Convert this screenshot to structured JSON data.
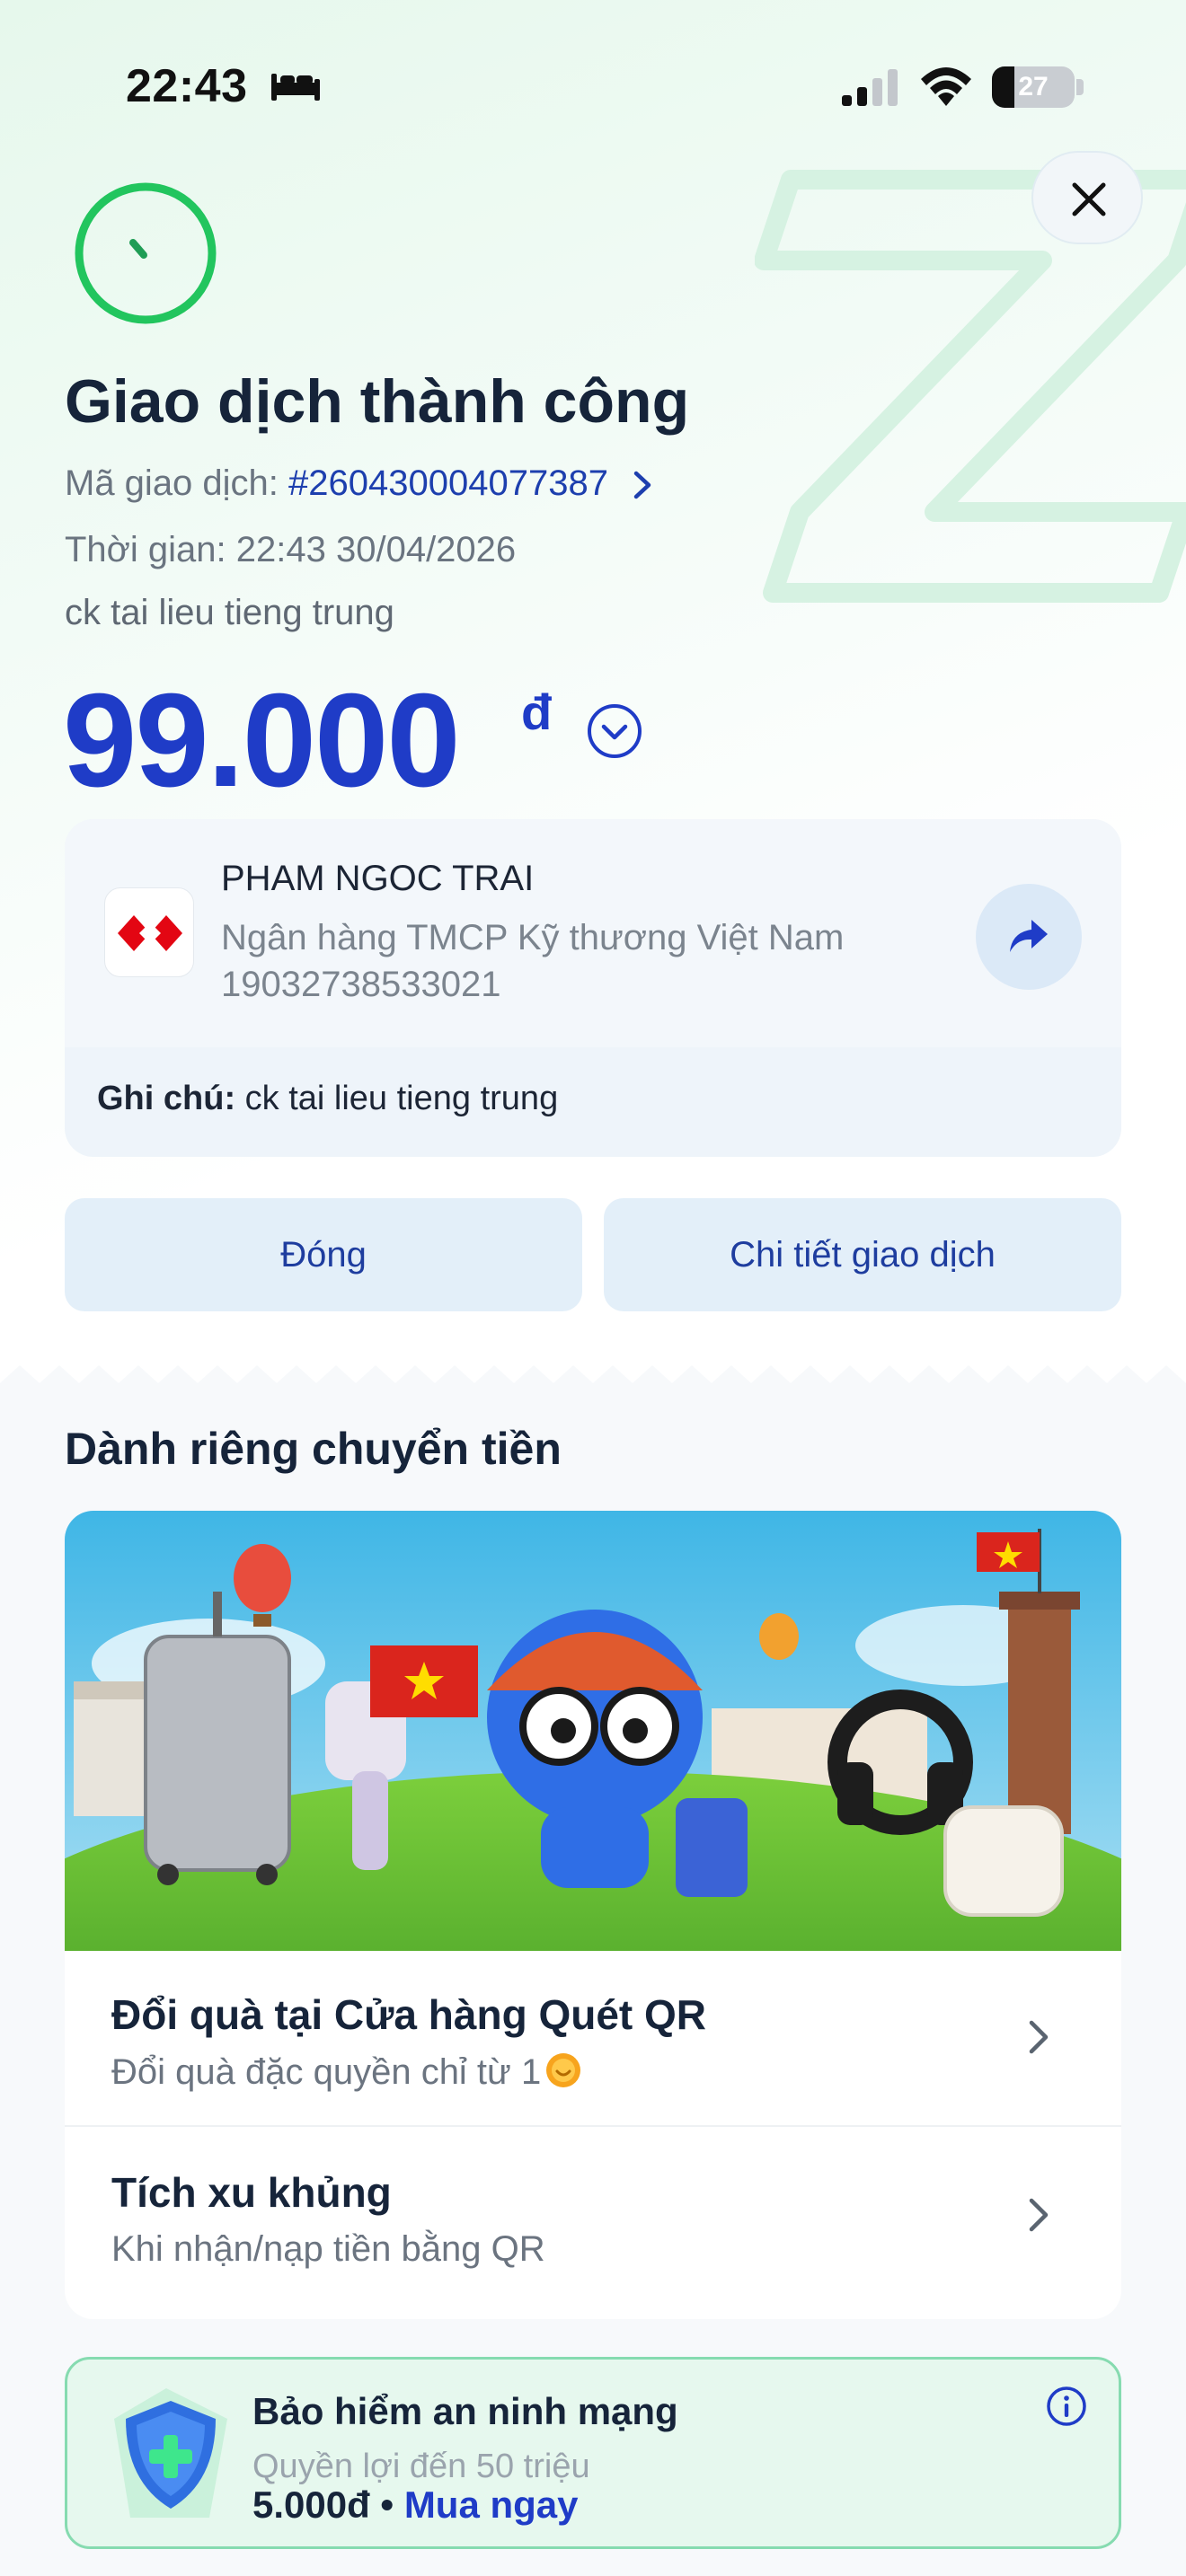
{
  "status_bar": {
    "time": "22:43",
    "battery_level": "27",
    "battery_fraction": 0.27
  },
  "header": {
    "title": "Giao dịch thành công",
    "txn_label": "Mã giao dịch: ",
    "txn_code": "#260430004077387",
    "time_text": "Thời gian: 22:43 30/04/2026",
    "note": "ck tai lieu tieng trung",
    "amount": "99.000",
    "currency": "đ"
  },
  "recipient": {
    "name": "PHAM NGOC TRAI",
    "bank": "Ngân hàng TMCP Kỹ thương Việt Nam",
    "account": "19032738533021",
    "memo_label": "Ghi chú:",
    "memo_value": " ck tai lieu tieng trung"
  },
  "actions": {
    "close_label": "Đóng",
    "detail_label": "Chi tiết giao dịch"
  },
  "section": {
    "title": "Dành riêng chuyển tiền"
  },
  "promos": [
    {
      "title": "Đổi quà tại Cửa hàng Quét QR",
      "subtitle": "Đổi quà đặc quyền chỉ từ 1"
    },
    {
      "title": "Tích xu khủng",
      "subtitle": "Khi nhận/nạp tiền bằng QR"
    }
  ],
  "insurance": {
    "title": "Bảo hiểm an ninh mạng",
    "benefit": "Quyền lợi đến 50 triệu",
    "price": "5.000đ",
    "separator": " • ",
    "buy_label": "Mua ngay"
  },
  "colors": {
    "accent": "#1f3cc7",
    "success": "#22c55e",
    "bank_red": "#e30613",
    "insurance_border": "#86dbb0"
  },
  "icons": [
    "bed-icon",
    "signal-icon",
    "wifi-icon",
    "battery-icon",
    "close-icon",
    "success-ring-icon",
    "chevron-right-icon",
    "chevron-down-circle-icon",
    "techcombank-logo-icon",
    "share-icon",
    "coin-icon",
    "shield-plus-icon",
    "info-icon"
  ]
}
